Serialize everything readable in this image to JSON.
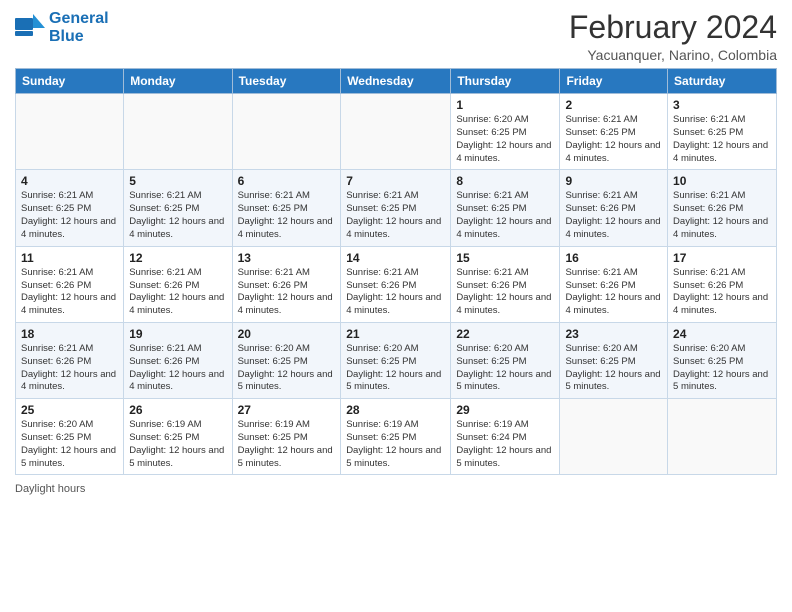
{
  "logo": {
    "line1": "General",
    "line2": "Blue"
  },
  "title": "February 2024",
  "subtitle": "Yacuanquer, Narino, Colombia",
  "days_of_week": [
    "Sunday",
    "Monday",
    "Tuesday",
    "Wednesday",
    "Thursday",
    "Friday",
    "Saturday"
  ],
  "weeks": [
    [
      {
        "day": "",
        "info": ""
      },
      {
        "day": "",
        "info": ""
      },
      {
        "day": "",
        "info": ""
      },
      {
        "day": "",
        "info": ""
      },
      {
        "day": "1",
        "info": "Sunrise: 6:20 AM\nSunset: 6:25 PM\nDaylight: 12 hours and 4 minutes."
      },
      {
        "day": "2",
        "info": "Sunrise: 6:21 AM\nSunset: 6:25 PM\nDaylight: 12 hours and 4 minutes."
      },
      {
        "day": "3",
        "info": "Sunrise: 6:21 AM\nSunset: 6:25 PM\nDaylight: 12 hours and 4 minutes."
      }
    ],
    [
      {
        "day": "4",
        "info": "Sunrise: 6:21 AM\nSunset: 6:25 PM\nDaylight: 12 hours and 4 minutes."
      },
      {
        "day": "5",
        "info": "Sunrise: 6:21 AM\nSunset: 6:25 PM\nDaylight: 12 hours and 4 minutes."
      },
      {
        "day": "6",
        "info": "Sunrise: 6:21 AM\nSunset: 6:25 PM\nDaylight: 12 hours and 4 minutes."
      },
      {
        "day": "7",
        "info": "Sunrise: 6:21 AM\nSunset: 6:25 PM\nDaylight: 12 hours and 4 minutes."
      },
      {
        "day": "8",
        "info": "Sunrise: 6:21 AM\nSunset: 6:25 PM\nDaylight: 12 hours and 4 minutes."
      },
      {
        "day": "9",
        "info": "Sunrise: 6:21 AM\nSunset: 6:26 PM\nDaylight: 12 hours and 4 minutes."
      },
      {
        "day": "10",
        "info": "Sunrise: 6:21 AM\nSunset: 6:26 PM\nDaylight: 12 hours and 4 minutes."
      }
    ],
    [
      {
        "day": "11",
        "info": "Sunrise: 6:21 AM\nSunset: 6:26 PM\nDaylight: 12 hours and 4 minutes."
      },
      {
        "day": "12",
        "info": "Sunrise: 6:21 AM\nSunset: 6:26 PM\nDaylight: 12 hours and 4 minutes."
      },
      {
        "day": "13",
        "info": "Sunrise: 6:21 AM\nSunset: 6:26 PM\nDaylight: 12 hours and 4 minutes."
      },
      {
        "day": "14",
        "info": "Sunrise: 6:21 AM\nSunset: 6:26 PM\nDaylight: 12 hours and 4 minutes."
      },
      {
        "day": "15",
        "info": "Sunrise: 6:21 AM\nSunset: 6:26 PM\nDaylight: 12 hours and 4 minutes."
      },
      {
        "day": "16",
        "info": "Sunrise: 6:21 AM\nSunset: 6:26 PM\nDaylight: 12 hours and 4 minutes."
      },
      {
        "day": "17",
        "info": "Sunrise: 6:21 AM\nSunset: 6:26 PM\nDaylight: 12 hours and 4 minutes."
      }
    ],
    [
      {
        "day": "18",
        "info": "Sunrise: 6:21 AM\nSunset: 6:26 PM\nDaylight: 12 hours and 4 minutes."
      },
      {
        "day": "19",
        "info": "Sunrise: 6:21 AM\nSunset: 6:26 PM\nDaylight: 12 hours and 4 minutes."
      },
      {
        "day": "20",
        "info": "Sunrise: 6:20 AM\nSunset: 6:25 PM\nDaylight: 12 hours and 5 minutes."
      },
      {
        "day": "21",
        "info": "Sunrise: 6:20 AM\nSunset: 6:25 PM\nDaylight: 12 hours and 5 minutes."
      },
      {
        "day": "22",
        "info": "Sunrise: 6:20 AM\nSunset: 6:25 PM\nDaylight: 12 hours and 5 minutes."
      },
      {
        "day": "23",
        "info": "Sunrise: 6:20 AM\nSunset: 6:25 PM\nDaylight: 12 hours and 5 minutes."
      },
      {
        "day": "24",
        "info": "Sunrise: 6:20 AM\nSunset: 6:25 PM\nDaylight: 12 hours and 5 minutes."
      }
    ],
    [
      {
        "day": "25",
        "info": "Sunrise: 6:20 AM\nSunset: 6:25 PM\nDaylight: 12 hours and 5 minutes."
      },
      {
        "day": "26",
        "info": "Sunrise: 6:19 AM\nSunset: 6:25 PM\nDaylight: 12 hours and 5 minutes."
      },
      {
        "day": "27",
        "info": "Sunrise: 6:19 AM\nSunset: 6:25 PM\nDaylight: 12 hours and 5 minutes."
      },
      {
        "day": "28",
        "info": "Sunrise: 6:19 AM\nSunset: 6:25 PM\nDaylight: 12 hours and 5 minutes."
      },
      {
        "day": "29",
        "info": "Sunrise: 6:19 AM\nSunset: 6:24 PM\nDaylight: 12 hours and 5 minutes."
      },
      {
        "day": "",
        "info": ""
      },
      {
        "day": "",
        "info": ""
      }
    ]
  ],
  "legend": {
    "daylight_label": "Daylight hours"
  }
}
